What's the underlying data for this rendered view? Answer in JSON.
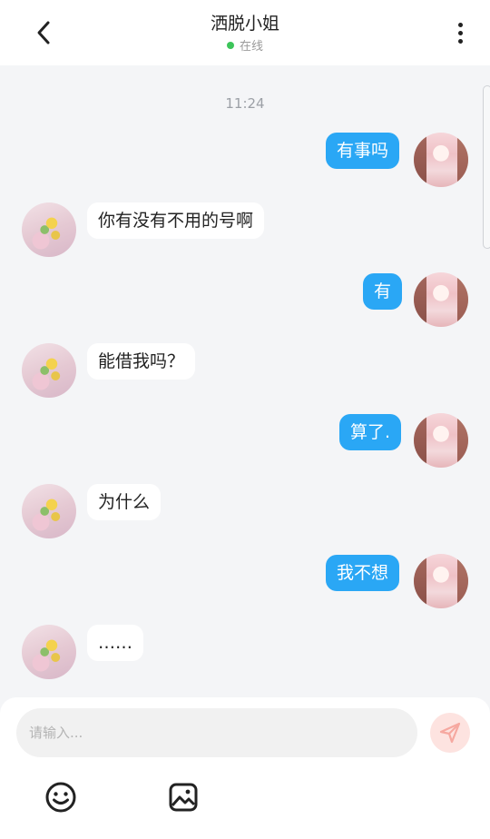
{
  "header": {
    "title": "洒脱小姐",
    "status": "在线",
    "status_color": "#3dc55a",
    "back_icon": "chevron-left-icon",
    "more_icon": "more-vertical-icon"
  },
  "chat": {
    "time": "11:24",
    "messages": [
      {
        "from": "me",
        "text": "有事吗"
      },
      {
        "from": "other",
        "text": "你有没有不用的号啊"
      },
      {
        "from": "me",
        "text": "有"
      },
      {
        "from": "other",
        "text": "能借我吗？"
      },
      {
        "from": "me",
        "text": "算了."
      },
      {
        "from": "other",
        "text": "为什么"
      },
      {
        "from": "me",
        "text": "我不想"
      },
      {
        "from": "other",
        "text": "……"
      }
    ],
    "bubble_me_color": "#2aa7f5",
    "bubble_other_color": "#ffffff"
  },
  "composer": {
    "placeholder": "请输入...",
    "send_icon": "send-icon",
    "emoji_icon": "smiley-icon",
    "image_icon": "image-icon"
  }
}
